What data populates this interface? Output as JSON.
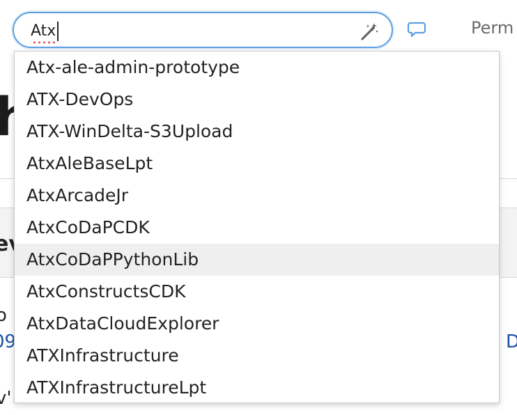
{
  "search": {
    "value": "Atx",
    "magic_icon": "magic-wand-icon"
  },
  "chat_icon": "speech-bubble-icon",
  "header": {
    "perm_label": "Perm"
  },
  "background": {
    "heading_fragment": "h",
    "subheading_fragment": "ev",
    "text_fragment_a": "o",
    "link_fragment_b": "09",
    "link_fragment_c": "D",
    "text_fragment_d": "v'"
  },
  "suggestions": [
    "Atx-ale-admin-prototype",
    "ATX-DevOps",
    "ATX-WinDelta-S3Upload",
    "AtxAleBaseLpt",
    "AtxArcadeJr",
    "AtxCoDaPCDK",
    "AtxCoDaPPythonLib",
    "AtxConstructsCDK",
    "AtxDataCloudExplorer",
    "ATXInfrastructure",
    "ATXInfrastructureLpt"
  ],
  "highlighted_index": 6,
  "colors": {
    "focus_border": "#5b9ee0",
    "link": "#1a4fa6",
    "highlight_row": "#efefef"
  }
}
